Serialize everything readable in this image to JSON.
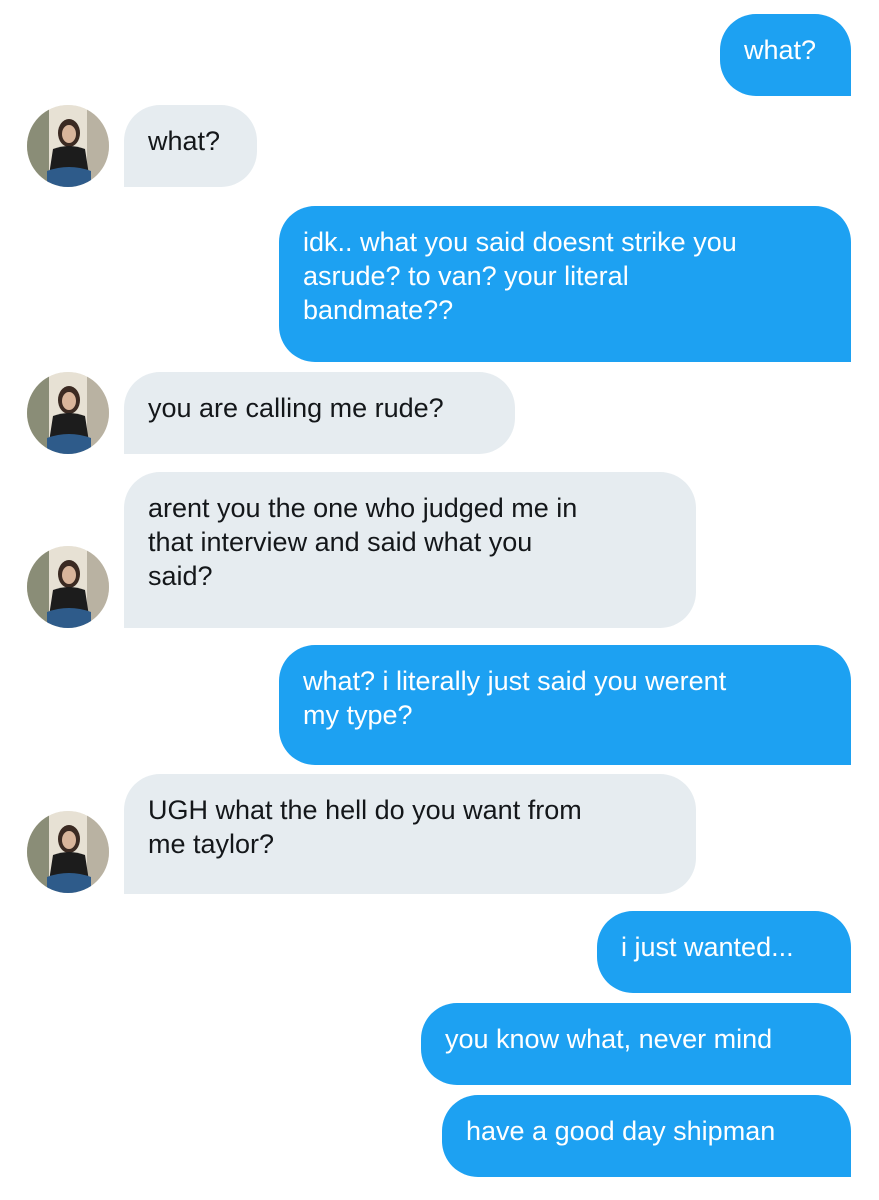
{
  "conversation": {
    "messages": [
      {
        "from": "me",
        "text": "what?"
      },
      {
        "from": "them",
        "text": "what?"
      },
      {
        "from": "me",
        "text": "idk.. what you said doesnt strike you\nasrude? to van? your literal\nbandmate??"
      },
      {
        "from": "them",
        "text": "you are calling me rude?"
      },
      {
        "from": "them",
        "text": "arent you the one who judged me in\nthat interview and said what you\nsaid?"
      },
      {
        "from": "me",
        "text": "what? i literally just said you werent\nmy type?"
      },
      {
        "from": "them",
        "text": "UGH what the hell do you want from\nme taylor?"
      },
      {
        "from": "me",
        "text": "i just wanted..."
      },
      {
        "from": "me",
        "text": "you know what, never mind"
      },
      {
        "from": "me",
        "text": "have a good day shipman"
      }
    ]
  },
  "colors": {
    "sent_bubble": "#1da1f2",
    "received_bubble": "#e6ecf0",
    "received_text": "#14171a",
    "background": "#ffffff"
  },
  "icons": {
    "avatar": "contact-avatar-photo"
  }
}
